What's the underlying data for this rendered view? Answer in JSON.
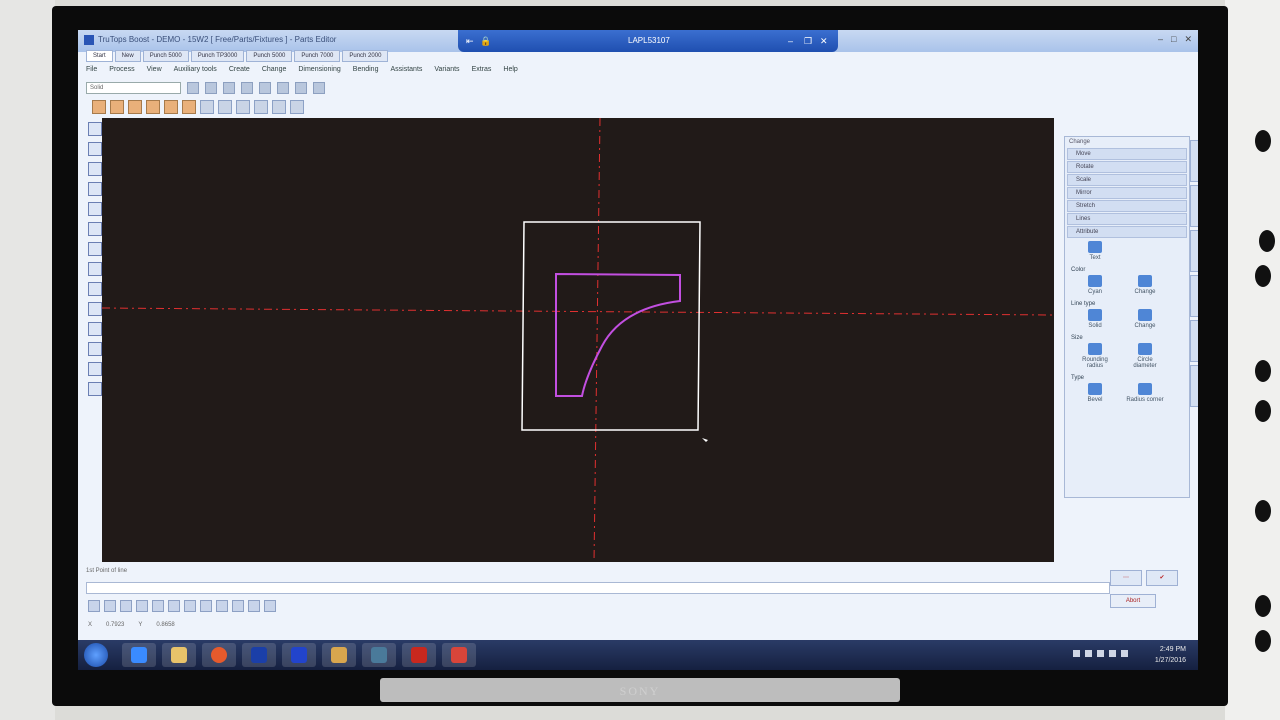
{
  "window": {
    "title": "TruTops Boost - DEMO - 15W2 [ Free/Parts/Fixtures ] - Parts Editor",
    "remote_host": "LAPL53107"
  },
  "tabs": [
    "Start",
    "New",
    "Punch 5000",
    "Punch TP3000",
    "Punch 5000",
    "Punch 7000",
    "Punch 2000"
  ],
  "menu": [
    "File",
    "Process",
    "View",
    "Auxiliary tools",
    "Create",
    "Change",
    "Dimensioning",
    "Bending",
    "Assistants",
    "Variants",
    "Extras",
    "Help"
  ],
  "toolbar": {
    "selector_value": "Solid"
  },
  "panel": {
    "header": "Change",
    "rows": [
      "Move",
      "Rotate",
      "Scale",
      "Mirror",
      "Stretch",
      "Lines",
      "Attribute"
    ],
    "text_label": "Text",
    "color_section": "Color",
    "color_tools": [
      "Cyan",
      "Change"
    ],
    "linetype_section": "Line type",
    "linetype_tools": [
      "Solid",
      "Change"
    ],
    "size_section": "Size",
    "size_tools": [
      "Rounding radius",
      "Circle diameter"
    ],
    "type_section": "Type",
    "type_tools": [
      "Bevel",
      "Radius corner"
    ]
  },
  "status": {
    "hint": "1st Point of line",
    "x_label": "X",
    "x_value": "0.7923",
    "y_label": "Y",
    "y_value": "0.8658",
    "abort_label": "Abort"
  },
  "taskbar": {
    "time": "2:49 PM",
    "date": "1/27/2016"
  },
  "tv": {
    "brand": "SONY"
  },
  "colors": {
    "canvas_bg": "#211a18",
    "part_outline": "#c24fe0",
    "frame_outline": "#ffffff",
    "axis_line": "#e03030"
  }
}
